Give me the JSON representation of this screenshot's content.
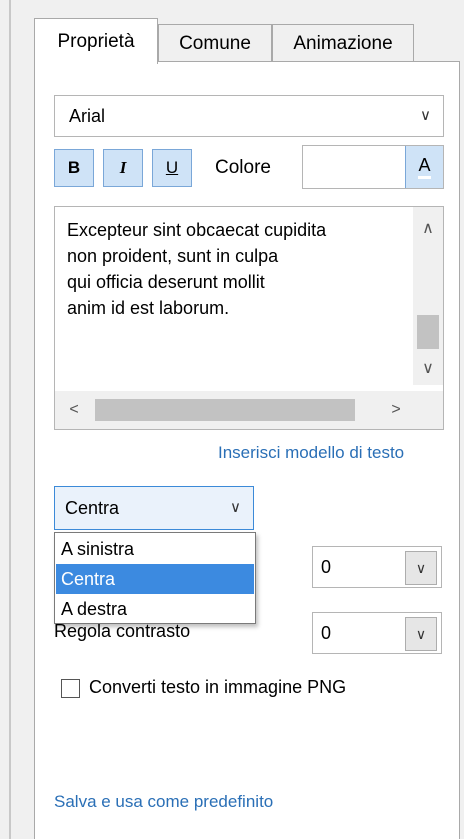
{
  "tabs": [
    {
      "label": "Proprietà",
      "active": true
    },
    {
      "label": "Comune",
      "active": false
    },
    {
      "label": "Animazione",
      "active": false
    }
  ],
  "font": {
    "selected": "Arial"
  },
  "format_buttons": {
    "bold": "B",
    "italic": "I",
    "underline": "U"
  },
  "color": {
    "label": "Colore",
    "button": "A"
  },
  "text_area": {
    "content": "Excepteur sint obcaecat cupidita\nnon proident, sunt in culpa\nqui officia deserunt mollit\nanim id est laborum."
  },
  "insert_template_link": "Inserisci modello di testo",
  "alignment": {
    "selected": "Centra",
    "options": [
      "A sinistra",
      "Centra",
      "A destra"
    ]
  },
  "spinner_1": {
    "value": "0"
  },
  "contrast": {
    "label": "Regola contrasto",
    "value": "0"
  },
  "png_checkbox": {
    "label": "Converti testo in immagine PNG",
    "checked": false
  },
  "save_default_link": "Salva e usa come predefinito"
}
